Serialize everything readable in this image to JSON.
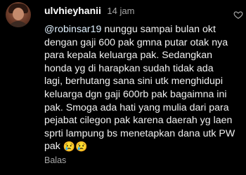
{
  "comment": {
    "username": "ulvhieyhanii",
    "timestamp": "14 jam",
    "mention": "@robinsar19",
    "lines": [
      " nunggu sampai bulan okt",
      "dengan gaji 600 pak gmna putar otak nya",
      "para kepala keluarga pak. Sedangkan",
      "honda yg di harapkan sudah tidak ada",
      "lagi, berhutang sana sini utk menghidupi",
      "keluarga dgn gaji 600rb pak bagaimna ini",
      "pak. Smoga ada hati yang mulia dari para",
      "pejabat cilegon pak karena daerah yg laen",
      "sprti lampung bs menetapkan dana utk PW",
      "pak "
    ],
    "emojis": [
      "😢",
      "😢"
    ],
    "reply_label": "Balas"
  },
  "icons": {
    "avatar": "user-avatar",
    "like": "heart-icon"
  },
  "colors": {
    "background": "#000000",
    "text": "#f0f0f0",
    "secondary": "#a8a8a8"
  }
}
